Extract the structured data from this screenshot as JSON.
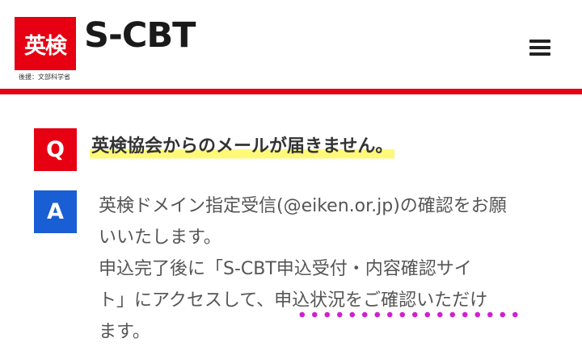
{
  "header": {
    "logo_kanji": "英検",
    "logo_text": "S-CBT",
    "logo_sub": "後援：文部科学省",
    "brand_color": "#e60012",
    "menu_icon": "hamburger-menu-icon"
  },
  "faq": {
    "q_label": "Q",
    "a_label": "A",
    "question": "英検協会からのメールが届きません。",
    "answer_lines": [
      "英検ドメイン指定受信(@eiken.or.jp)の確認をお願",
      "いいたします。",
      "申込完了後に「S-CBT申込受付・内容確認サイ",
      "ト」にアクセスして、申込状況をご確認いただけ",
      "ます。"
    ],
    "highlight_color": "#fff97a",
    "q_color": "#e60012",
    "a_color": "#1a5ed6"
  }
}
